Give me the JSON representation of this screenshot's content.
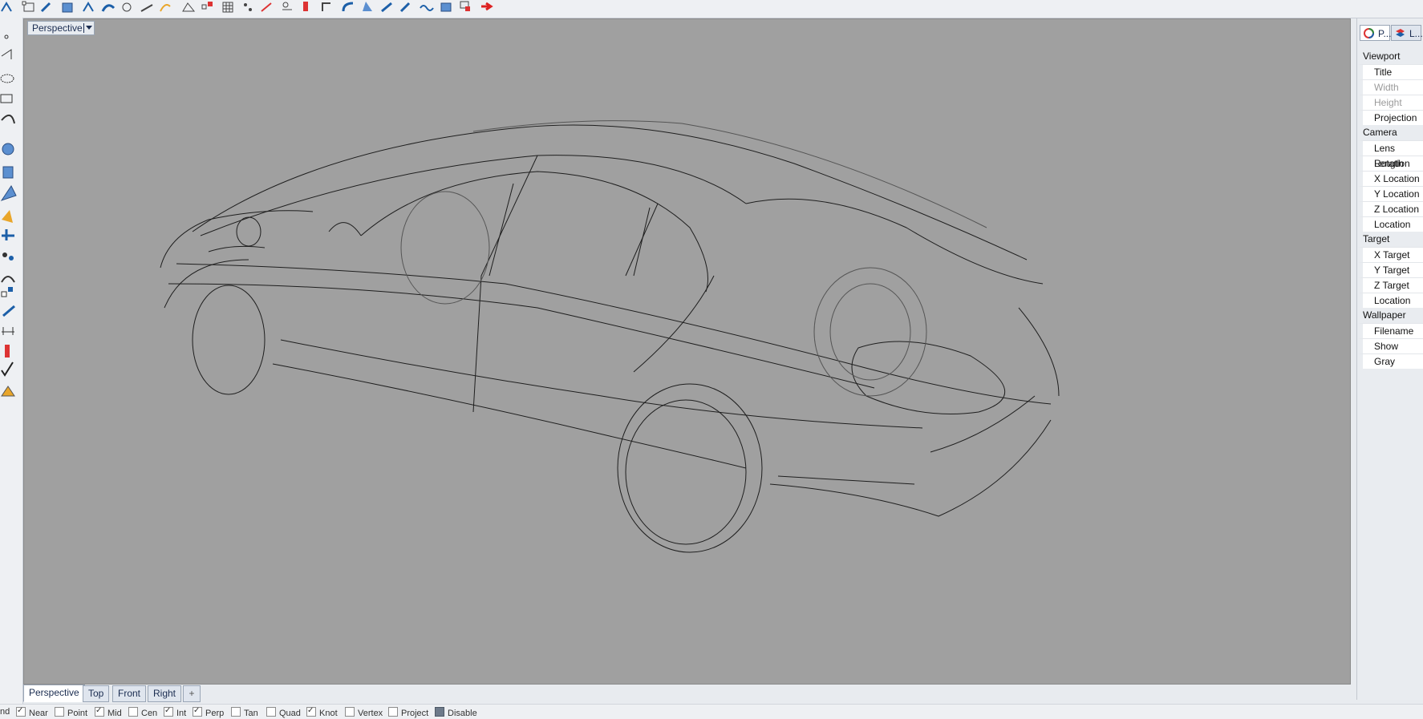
{
  "viewport": {
    "title": "Perspective"
  },
  "tabs": [
    {
      "label": "Perspective",
      "active": true
    },
    {
      "label": "Top",
      "active": false
    },
    {
      "label": "Front",
      "active": false
    },
    {
      "label": "Right",
      "active": false
    },
    {
      "label": "+",
      "active": false
    }
  ],
  "osnaps": [
    {
      "label": "nd",
      "checked": false
    },
    {
      "label": "Near",
      "checked": true
    },
    {
      "label": "Point",
      "checked": false
    },
    {
      "label": "Mid",
      "checked": true
    },
    {
      "label": "Cen",
      "checked": false
    },
    {
      "label": "Int",
      "checked": true
    },
    {
      "label": "Perp",
      "checked": true
    },
    {
      "label": "Tan",
      "checked": false
    },
    {
      "label": "Quad",
      "checked": false
    },
    {
      "label": "Knot",
      "checked": true
    },
    {
      "label": "Vertex",
      "checked": false
    },
    {
      "label": "Project",
      "checked": false
    },
    {
      "label": "Disable",
      "checked": true
    }
  ],
  "panel_tabs": [
    {
      "label": "P...",
      "icon": "properties-icon"
    },
    {
      "label": "L...",
      "icon": "layers-icon"
    }
  ],
  "properties": [
    {
      "section": "Viewport",
      "rows": [
        {
          "label": "Title",
          "enabled": true
        },
        {
          "label": "Width",
          "enabled": false
        },
        {
          "label": "Height",
          "enabled": false
        },
        {
          "label": "Projection",
          "enabled": true
        }
      ]
    },
    {
      "section": "Camera",
      "rows": [
        {
          "label": "Lens Length",
          "enabled": true
        },
        {
          "label": "Rotation",
          "enabled": true
        },
        {
          "label": "X Location",
          "enabled": true
        },
        {
          "label": "Y Location",
          "enabled": true
        },
        {
          "label": "Z Location",
          "enabled": true
        },
        {
          "label": "Location",
          "enabled": true
        }
      ]
    },
    {
      "section": "Target",
      "rows": [
        {
          "label": "X Target",
          "enabled": true
        },
        {
          "label": "Y Target",
          "enabled": true
        },
        {
          "label": "Z Target",
          "enabled": true
        },
        {
          "label": "Location",
          "enabled": true
        }
      ]
    },
    {
      "section": "Wallpaper",
      "rows": [
        {
          "label": "Filename",
          "enabled": true
        },
        {
          "label": "Show",
          "enabled": true
        },
        {
          "label": "Gray",
          "enabled": true
        }
      ]
    }
  ],
  "colors": {
    "viewport_bg": "#a0a0a0",
    "wire": "#1e1e1e",
    "accent": "#1a2c50"
  }
}
